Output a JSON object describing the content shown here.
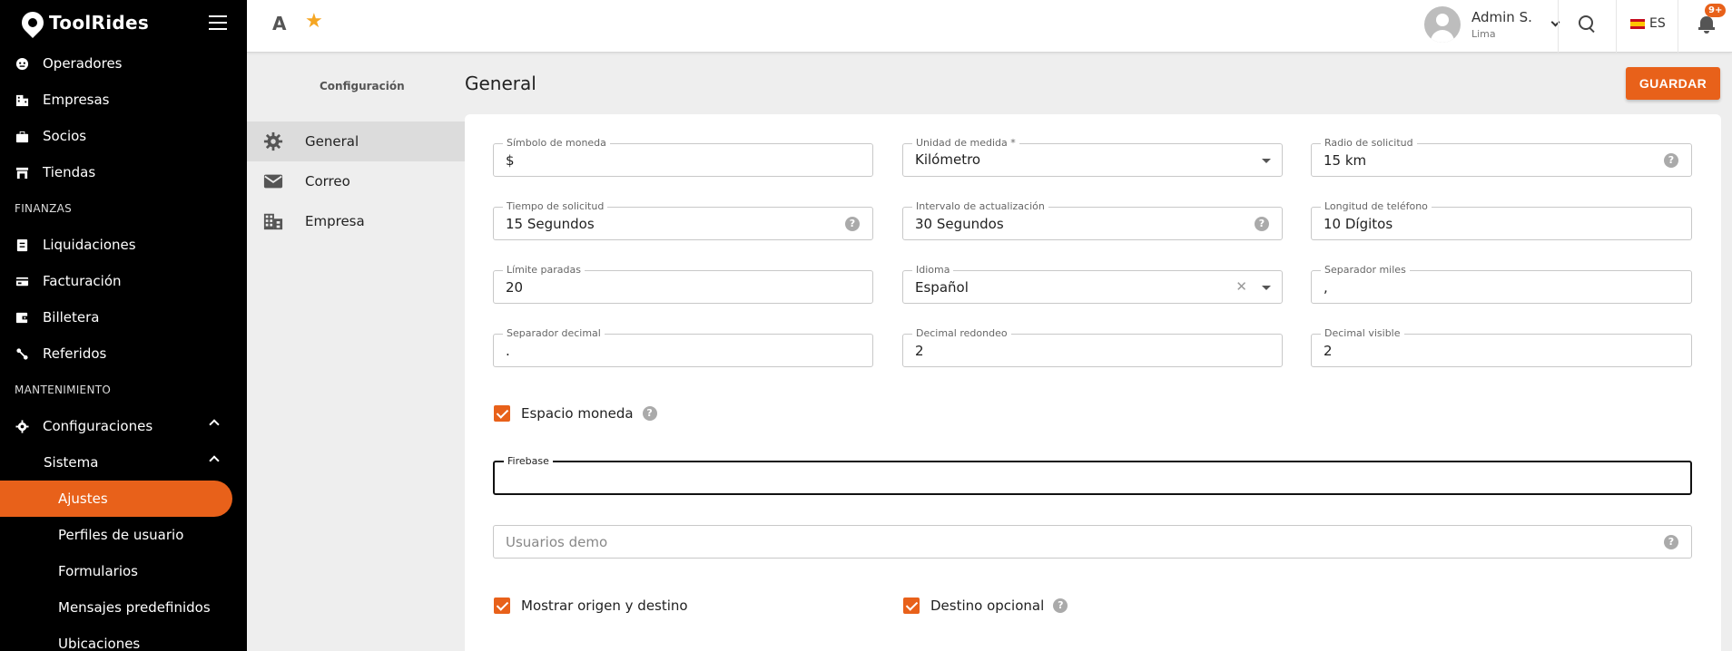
{
  "brand": {
    "name": "ToolRides"
  },
  "sidebar": {
    "items": [
      {
        "label": "Operadores"
      },
      {
        "label": "Empresas"
      },
      {
        "label": "Socios"
      },
      {
        "label": "Tiendas"
      }
    ],
    "section_finanzas": "FINANZAS",
    "finanzas": [
      {
        "label": "Liquidaciones"
      },
      {
        "label": "Facturación"
      },
      {
        "label": "Billetera"
      },
      {
        "label": "Referidos"
      }
    ],
    "section_mantenimiento": "MANTENIMIENTO",
    "configuraciones": "Configuraciones",
    "sistema": "Sistema",
    "sistema_items": [
      {
        "label": "Ajustes"
      },
      {
        "label": "Perfiles de usuario"
      },
      {
        "label": "Formularios"
      },
      {
        "label": "Mensajes predefinidos"
      },
      {
        "label": "Ubicaciones"
      }
    ]
  },
  "topbar": {
    "font_icon": "A",
    "user_name": "Admin S.",
    "user_location": "Lima",
    "language": "ES",
    "notifications_badge": "9+"
  },
  "settings_nav": {
    "title": "Configuración",
    "items": [
      {
        "label": "General",
        "icon": "gear-icon"
      },
      {
        "label": "Correo",
        "icon": "mail-icon"
      },
      {
        "label": "Empresa",
        "icon": "building-icon"
      }
    ]
  },
  "main": {
    "title": "General",
    "save_label": "GUARDAR",
    "fields": {
      "currency_symbol": {
        "label": "Símbolo de moneda",
        "value": "$"
      },
      "unit": {
        "label": "Unidad de medida *",
        "value": "Kilómetro"
      },
      "radius": {
        "label": "Radio de solicitud",
        "value": "15 km"
      },
      "request_time": {
        "label": "Tiempo de solicitud",
        "value": "15 Segundos"
      },
      "update_interval": {
        "label": "Intervalo de actualización",
        "value": "30 Segundos"
      },
      "phone_length": {
        "label": "Longitud de teléfono",
        "value": "10 Dígitos"
      },
      "stops_limit": {
        "label": "Límite paradas",
        "value": "20"
      },
      "language": {
        "label": "Idioma",
        "value": "Español"
      },
      "thousands_sep": {
        "label": "Separador miles",
        "value": ","
      },
      "decimal_sep": {
        "label": "Separador decimal",
        "value": "."
      },
      "decimal_round": {
        "label": "Decimal redondeo",
        "value": "2"
      },
      "decimal_visible": {
        "label": "Decimal visible",
        "value": "2"
      },
      "firebase": {
        "label": "Firebase",
        "value": ""
      },
      "demo_users": {
        "placeholder": "Usuarios demo"
      }
    },
    "checkboxes": {
      "currency_space": "Espacio moneda",
      "show_origin_dest": "Mostrar origen y destino",
      "optional_dest": "Destino opcional"
    }
  },
  "colors": {
    "accent": "#e8611a",
    "sidebar_bg": "#000000"
  }
}
